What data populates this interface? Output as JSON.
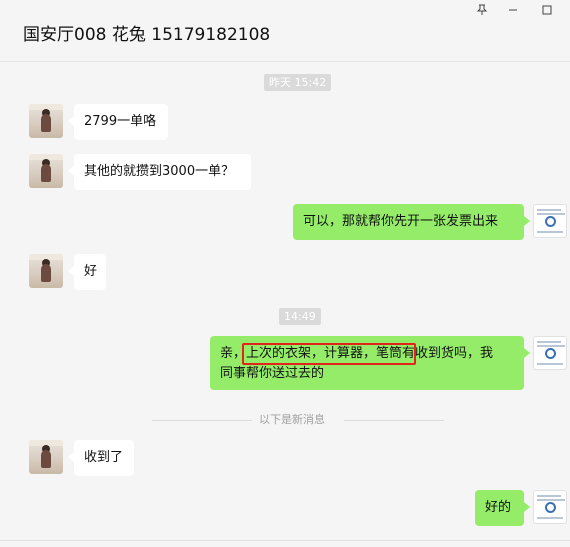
{
  "window": {
    "title": "国安厅008  花兔 15179182108",
    "pin_icon": "pin-icon",
    "minimize_icon": "minimize-icon",
    "maximize_icon": "maximize-icon"
  },
  "chat": {
    "timestamps": [
      "昨天 15:42",
      "14:49"
    ],
    "messages": [
      {
        "side": "left",
        "text": "2799一单咯"
      },
      {
        "side": "left",
        "text": "其他的就攒到3000一单？"
      },
      {
        "side": "right",
        "text": "可以，那就帮你先开一张发票出来"
      },
      {
        "side": "left",
        "text": "好"
      },
      {
        "side": "right",
        "line1": "亲，上次的衣架，计算器，笔筒有收到货吗，我",
        "line2": "同事帮你送过去的"
      },
      {
        "side": "left",
        "text": "收到了"
      },
      {
        "side": "right",
        "text": "好的"
      }
    ],
    "new_messages_divider": "以下是新消息"
  },
  "colors": {
    "sent_bubble": "#95ec69",
    "received_bubble": "#ffffff",
    "highlight_box": "#e0261b",
    "background": "#f5f5f5"
  }
}
